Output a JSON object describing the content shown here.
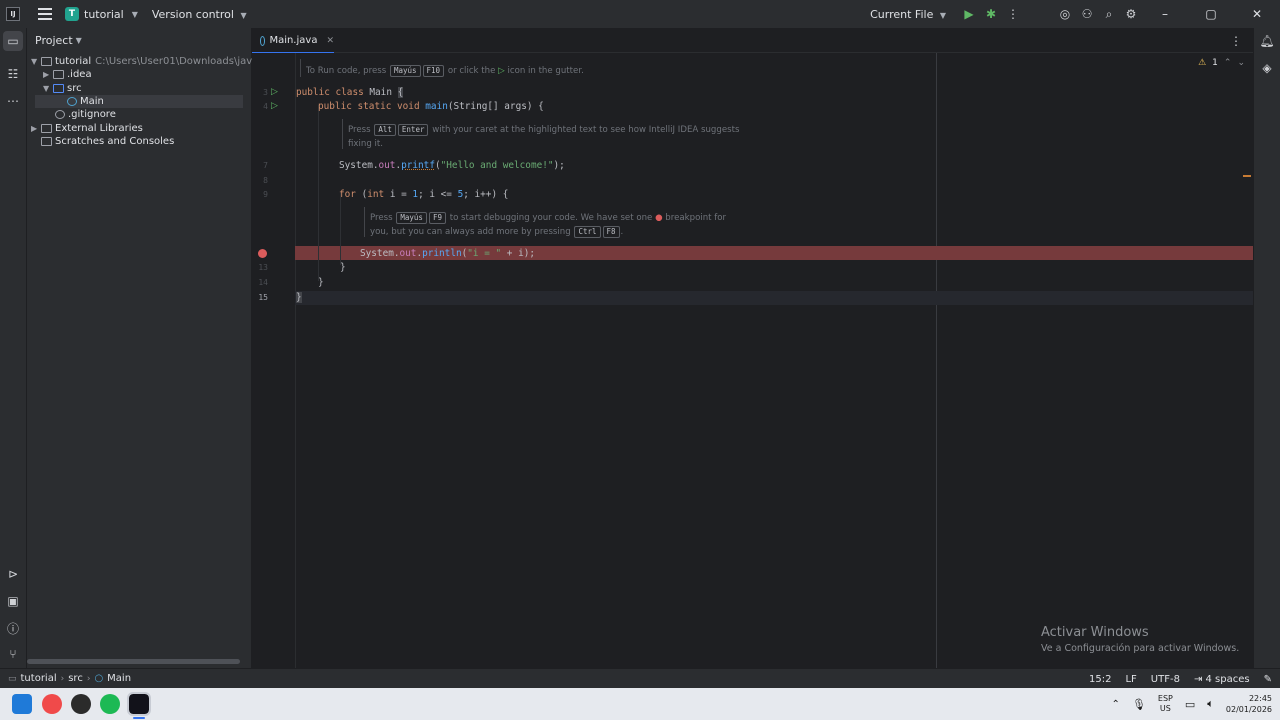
{
  "titlebar": {
    "project_badge": "T",
    "project_name": "tutorial",
    "version_control": "Version control",
    "run_config": "Current File"
  },
  "project_panel": {
    "header": "Project",
    "tree": [
      {
        "label": "tutorial",
        "path": "C:\\Users\\User01\\Downloads\\java\\tutorial"
      },
      {
        "label": ".idea"
      },
      {
        "label": "src"
      },
      {
        "label": "Main"
      },
      {
        "label": ".gitignore"
      },
      {
        "label": "External Libraries"
      },
      {
        "label": "Scratches and Consoles"
      }
    ]
  },
  "editor": {
    "tab_label": "Main.java",
    "problems_count": "1",
    "line_numbers": [
      "3",
      "4",
      "7",
      "8",
      "9",
      "12",
      "13",
      "14",
      "15"
    ],
    "hint_run": {
      "pre": "To Run code, press",
      "k1": "Mayús",
      "k2": "F10",
      "post": "or click the",
      "post2": "icon in the gutter."
    },
    "hint_fix": {
      "pre": "Press",
      "k1": "Alt",
      "k2": "Enter",
      "post": "with your caret at the highlighted text to see how IntelliJ IDEA suggests",
      "line2": "fixing it."
    },
    "hint_debug": {
      "pre": "Press",
      "k1": "Mayús",
      "k2": "F9",
      "post": "to start debugging your code. We have set one",
      "post2": "breakpoint for",
      "line2a": "you, but you can always add more by pressing",
      "k3": "Ctrl",
      "k4": "F8",
      "line2b": "."
    },
    "code": {
      "l3": {
        "kw": "public class",
        "name": "Main",
        "brace": "{"
      },
      "l4": {
        "kw": "public static void",
        "fn": "main",
        "rest": "(String[] args) {"
      },
      "l7": {
        "a": "System.",
        "fld": "out",
        "b": ".",
        "fn": "printf",
        "c": "(",
        "str": "\"Hello and welcome!\"",
        "d": ");"
      },
      "l9": {
        "kw1": "for",
        "a": " (",
        "kw2": "int",
        "b": " i = ",
        "n1": "1",
        "c": "; i <= ",
        "n2": "5",
        "d": "; i++) {"
      },
      "l12": {
        "a": "System.",
        "fld": "out",
        "b": ".",
        "fn": "println",
        "c": "(",
        "str": "\"i = \"",
        "d": " + i);"
      },
      "l13": "}",
      "l14": "}",
      "l15": "}"
    }
  },
  "watermark": {
    "title": "Activar Windows",
    "subtitle": "Ve a Configuración para activar Windows."
  },
  "statusbar": {
    "crumbs": [
      "tutorial",
      "src",
      "Main"
    ],
    "position": "15:2",
    "line_sep": "LF",
    "encoding": "UTF-8",
    "indent": "4 spaces"
  },
  "taskbar": {
    "lang_top": "ESP",
    "lang_bottom": "US",
    "time": "22:45",
    "date": "02/01/2026"
  },
  "colors": {
    "accent": "#3574f0",
    "breakpoint_line": "#763a3c",
    "breakpoint_dot": "#db5c5c",
    "run_green": "#5fb865"
  }
}
